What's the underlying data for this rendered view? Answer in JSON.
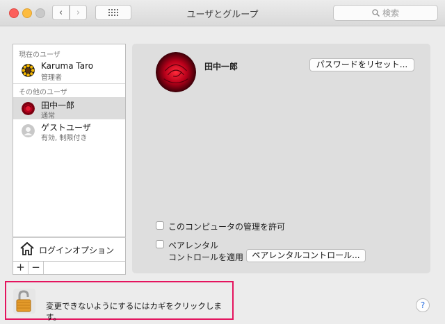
{
  "window": {
    "title": "ユーザとグループ"
  },
  "toolbar": {
    "back": "‹",
    "forward": "›",
    "search_placeholder": "検索"
  },
  "sidebar": {
    "current_label": "現在のユーザ",
    "current_user": {
      "name": "Karuma Taro",
      "role": "管理者"
    },
    "other_label": "その他のユーザ",
    "other_users": [
      {
        "name": "田中一郎",
        "role": "通常"
      },
      {
        "name": "ゲストユーザ",
        "role": "有効, 制限付き"
      }
    ],
    "login_options": "ログインオプション",
    "add": "+",
    "remove": "−"
  },
  "detail": {
    "user_name": "田中一郎",
    "reset_password": "パスワードをリセット...",
    "allow_admin": "このコンピュータの管理を許可",
    "parental_line1": "ペアレンタル",
    "parental_line2": "コントロールを適用",
    "parental_button": "ペアレンタルコントロール..."
  },
  "footer": {
    "lock_message": "変更できないようにするにはカギをクリックします。",
    "help": "?"
  },
  "colors": {
    "highlight_border": "#e4145e",
    "selected_row": "#dcdcdc",
    "help_blue": "#2a6fe0"
  }
}
